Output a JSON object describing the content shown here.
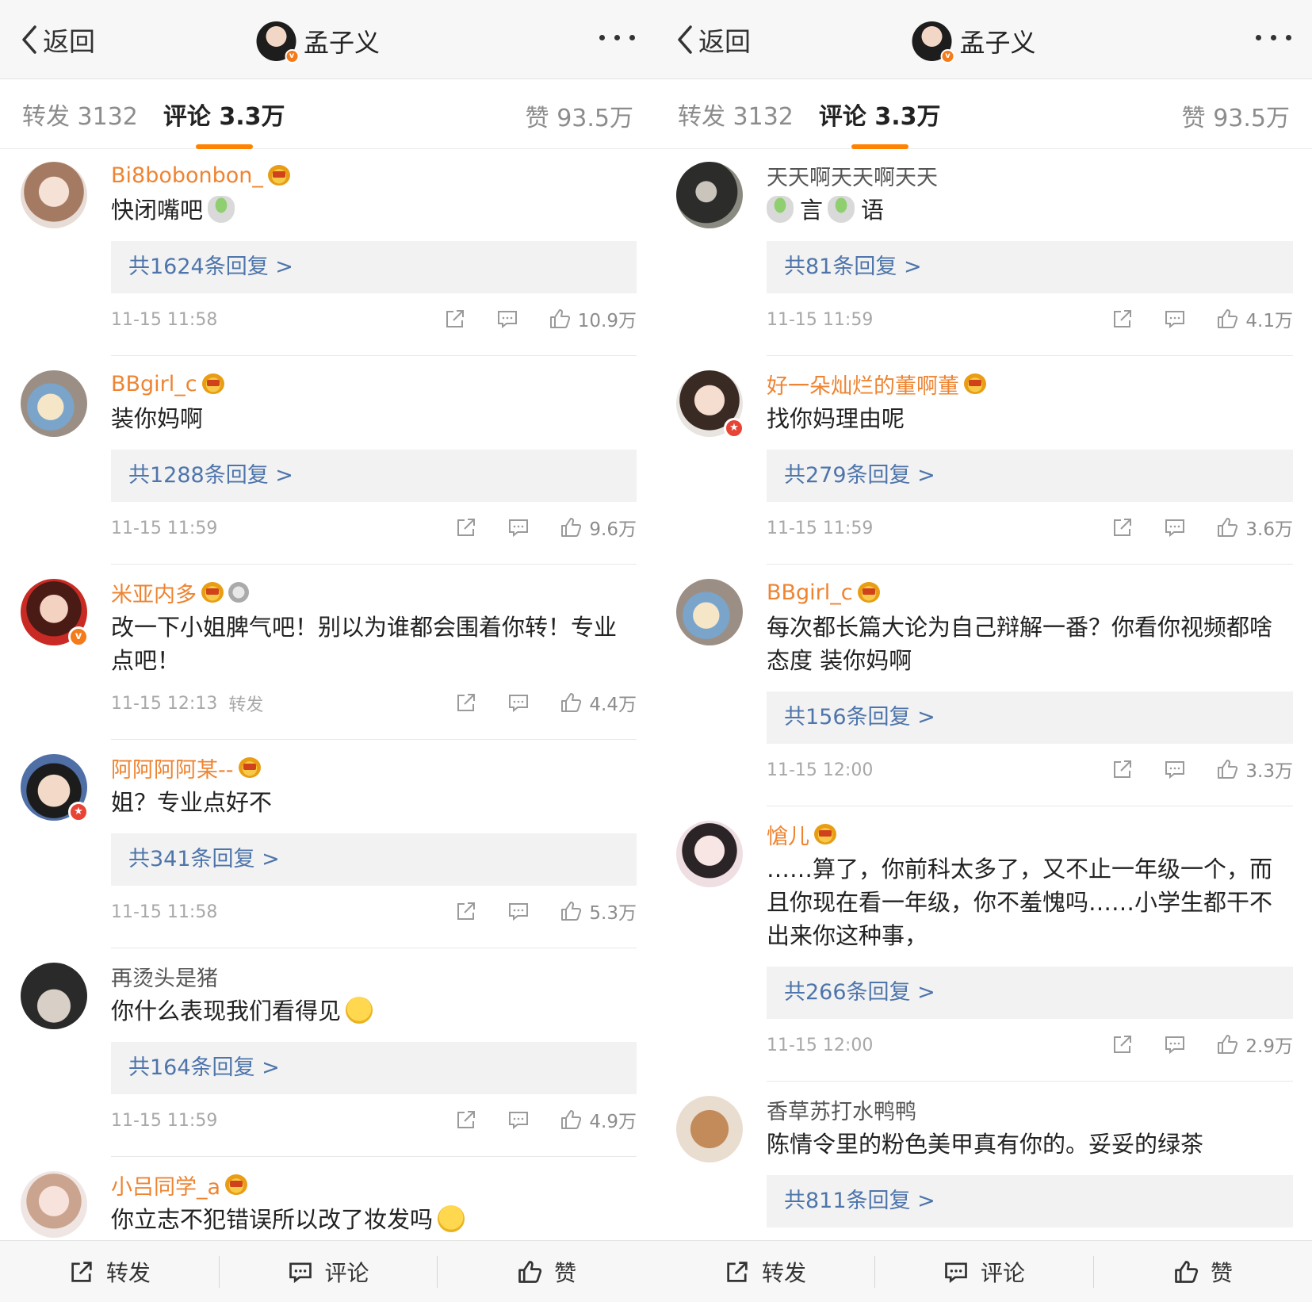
{
  "header": {
    "back_label": "返回",
    "title": "孟子义"
  },
  "tabs": {
    "repost": "转发 3132",
    "comment": "评论 3.3万",
    "like": "赞 93.5万"
  },
  "bottom": {
    "repost": "转发",
    "comment": "评论",
    "like": "赞"
  },
  "left_comments": [
    {
      "name": "Bi8bobonbon_",
      "text": "快闭嘴吧",
      "replies": "共1624条回复 >",
      "time": "11-15 11:58",
      "extra": "",
      "likes": "10.9万"
    },
    {
      "name": "BBgirl_c",
      "text": "装你妈啊",
      "replies": "共1288条回复 >",
      "time": "11-15 11:59",
      "extra": "",
      "likes": "9.6万"
    },
    {
      "name": "米亚内多",
      "text": "改一下小姐脾气吧！别以为谁都会围着你转！专业点吧！",
      "replies": "",
      "time": "11-15 12:13",
      "extra": "转发",
      "likes": "4.4万"
    },
    {
      "name": "阿阿阿阿某--",
      "text": "姐？专业点好不",
      "replies": "共341条回复 >",
      "time": "11-15 11:58",
      "extra": "",
      "likes": "5.3万"
    },
    {
      "name": "再烫头是猪",
      "text": "你什么表现我们看得见",
      "replies": "共164条回复 >",
      "time": "11-15 11:59",
      "extra": "",
      "likes": "4.9万"
    },
    {
      "name": "小吕同学_a",
      "text": "你立志不犯错误所以改了妆发吗",
      "replies": "",
      "time": "",
      "extra": "",
      "likes": ""
    }
  ],
  "right_comments": [
    {
      "name": "天天啊天天啊天天",
      "text_a": "言",
      "text_b": "语",
      "replies": "共81条回复 >",
      "time": "11-15 11:59",
      "likes": "4.1万"
    },
    {
      "name": "好一朵灿烂的董啊董",
      "text": "找你妈理由呢",
      "replies": "共279条回复 >",
      "time": "11-15 11:59",
      "likes": "3.6万"
    },
    {
      "name": "BBgirl_c",
      "text": "每次都长篇大论为自己辩解一番？你看你视频都啥态度 装你妈啊",
      "replies": "共156条回复 >",
      "time": "11-15 12:00",
      "likes": "3.3万"
    },
    {
      "name": "愴儿",
      "text": "……算了，你前科太多了，又不止一年级一个，而且你现在看一年级，你不羞愧吗……小学生都干不出来你这种事，",
      "replies": "共266条回复 >",
      "time": "11-15 12:00",
      "likes": "2.9万"
    },
    {
      "name": "香草苏打水鸭鸭",
      "text": "陈情令里的粉色美甲真有你的。妥妥的绿茶",
      "replies": "共811条回复 >",
      "time": "",
      "likes": ""
    }
  ],
  "colors": {
    "accent": "#ff8200",
    "name_orange": "#ee8431",
    "link_blue": "#4e75ab"
  }
}
